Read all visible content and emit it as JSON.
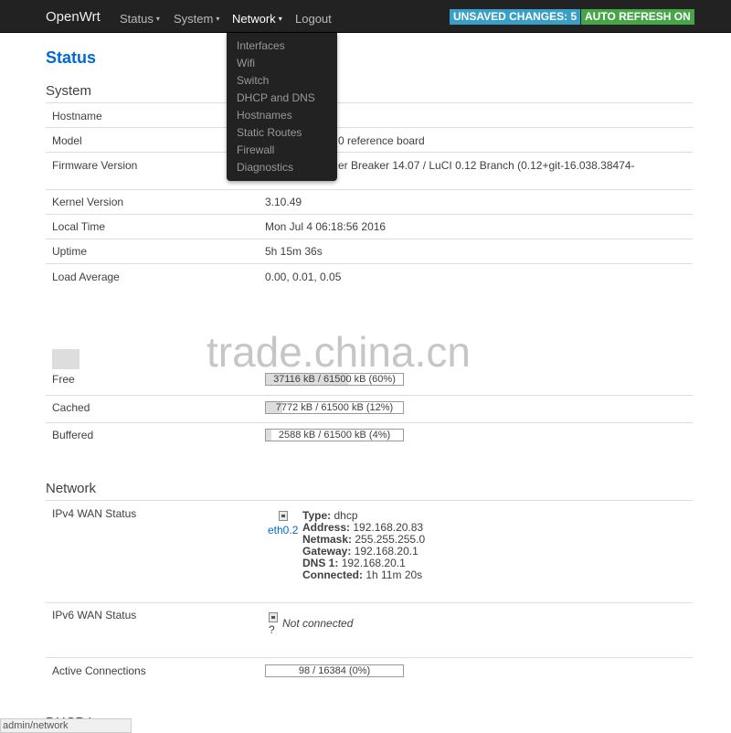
{
  "navbar": {
    "brand": "OpenWrt",
    "menus": [
      {
        "label": "Status"
      },
      {
        "label": "System"
      },
      {
        "label": "Network"
      },
      {
        "label": "Logout"
      }
    ],
    "caret": "▾",
    "unsaved": "UNSAVED CHANGES: 5",
    "refresh": "AUTO REFRESH ON"
  },
  "dropdown": {
    "items": [
      "Interfaces",
      "Wifi",
      "Switch",
      "DHCP and DNS",
      "Hostnames",
      "Static Routes",
      "Firewall",
      "Diagnostics"
    ]
  },
  "page": {
    "title": "Status"
  },
  "system": {
    "title": "System",
    "rows": [
      {
        "label": "Hostname",
        "value": ""
      },
      {
        "label": "Model",
        "value": "0 reference board"
      },
      {
        "label": "Firmware Version",
        "value": "er Breaker 14.07 / LuCI 0.12 Branch (0.12+git-16.038.38474-"
      },
      {
        "label": "Kernel Version",
        "value": "3.10.49"
      },
      {
        "label": "Local Time",
        "value": "Mon Jul 4 06:18:56 2016"
      },
      {
        "label": "Uptime",
        "value": "5h 15m 36s"
      },
      {
        "label": "Load Average",
        "value": "0.00, 0.01, 0.05"
      }
    ]
  },
  "memory": {
    "rows": [
      {
        "label": "Free",
        "text": "37116 kB / 61500 kB (60%)",
        "percent": 60
      },
      {
        "label": "Cached",
        "text": "7772 kB / 61500 kB (12%)",
        "percent": 12
      },
      {
        "label": "Buffered",
        "text": "2588 kB / 61500 kB (4%)",
        "percent": 4
      }
    ]
  },
  "network": {
    "title": "Network",
    "ipv4": {
      "label": "IPv4 WAN Status",
      "iface": "eth0.2",
      "lines": [
        {
          "key": "Type:",
          "val": "dhcp"
        },
        {
          "key": "Address:",
          "val": "192.168.20.83"
        },
        {
          "key": "Netmask:",
          "val": "255.255.255.0"
        },
        {
          "key": "Gateway:",
          "val": "192.168.20.1"
        },
        {
          "key": "DNS 1:",
          "val": "192.168.20.1"
        },
        {
          "key": "Connected:",
          "val": "1h 11m 20s"
        }
      ]
    },
    "ipv6": {
      "label": "IPv6 WAN Status",
      "icon_text": "?",
      "status": "Not connected"
    },
    "connections": {
      "label": "Active Connections",
      "text": "98 / 16384 (0%)",
      "percent": 0
    }
  },
  "dhcp_partial": "DHCP L",
  "statusbar": "admin/network",
  "watermark": "trade.china.cn",
  "colors": {
    "link": "#0069d6",
    "navbar": "#222222",
    "unsaved": "#3a9fc6",
    "refresh": "#46a546"
  }
}
